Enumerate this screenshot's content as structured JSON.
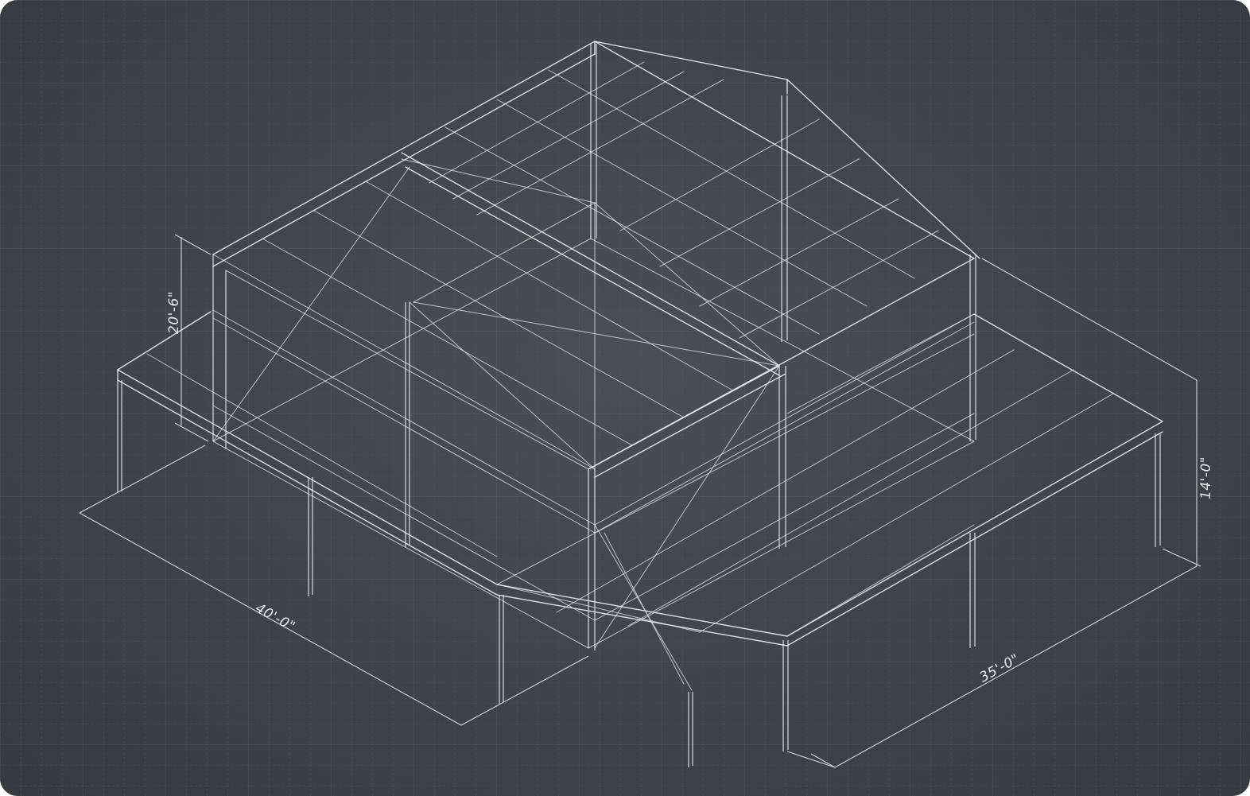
{
  "dimensions": {
    "length": "40'-0\"",
    "width": "35'-0\"",
    "eave_height": "14'-0\"",
    "wall_height": "20'-6\""
  },
  "colors": {
    "background": "#404347",
    "grid": "#5a5e62",
    "line": "#e9ecef"
  }
}
